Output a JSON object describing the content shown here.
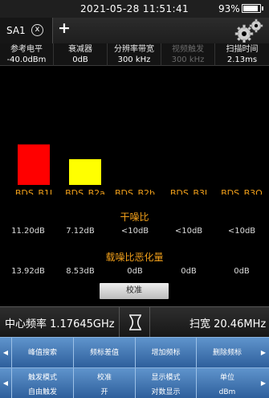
{
  "status": {
    "time": "2021-05-28 11:51:41",
    "battery": "93%",
    "battery_level": 0.93
  },
  "tabs": {
    "active_label": "SA1",
    "close_glyph": "x",
    "add_glyph": "+"
  },
  "params": [
    {
      "label": "参考电平",
      "value": "-40.0dBm",
      "enabled": true
    },
    {
      "label": "衰减器",
      "value": "0dB",
      "enabled": true
    },
    {
      "label": "分辨率带宽",
      "value": "300 kHz",
      "enabled": true
    },
    {
      "label": "视频触发",
      "value": "300 kHz",
      "enabled": false
    },
    {
      "label": "扫描时间",
      "value": "2.13ms",
      "enabled": true
    }
  ],
  "chart_data": {
    "type": "bar",
    "categories": [
      "BDS_B1I",
      "BDS_B2a",
      "BDS_B2b",
      "BDS_B3I",
      "BDS_B3Q"
    ],
    "values": [
      11.2,
      7.12,
      null,
      null,
      null
    ],
    "colors": [
      "#ff0000",
      "#ffff00",
      null,
      null,
      null
    ],
    "label_color": "#f2a01a",
    "ylim": [
      0,
      20
    ],
    "tables": [
      {
        "title": "干噪比",
        "values": [
          "11.20dB",
          "7.12dB",
          "<10dB",
          "<10dB",
          "<10dB"
        ]
      },
      {
        "title": "载噪比恶化量",
        "values": [
          "13.92dB",
          "8.53dB",
          "0dB",
          "0dB",
          "0dB"
        ]
      }
    ]
  },
  "calibrate_label": "校准",
  "frequency": {
    "center": "中心频率 1.17645GHz",
    "span": "扫宽 20.46MHz"
  },
  "softkeys_row1": [
    "峰值搜索",
    "频标差值",
    "增加频标",
    "删除频标"
  ],
  "softkeys_row2": [
    {
      "line1": "触发模式",
      "line2": "自由触发"
    },
    {
      "line1": "校准",
      "line2": "开"
    },
    {
      "line1": "显示模式",
      "line2": "对数显示"
    },
    {
      "line1": "单位",
      "line2": "dBm"
    }
  ],
  "arrows": {
    "left": "◀",
    "right": "▶"
  }
}
